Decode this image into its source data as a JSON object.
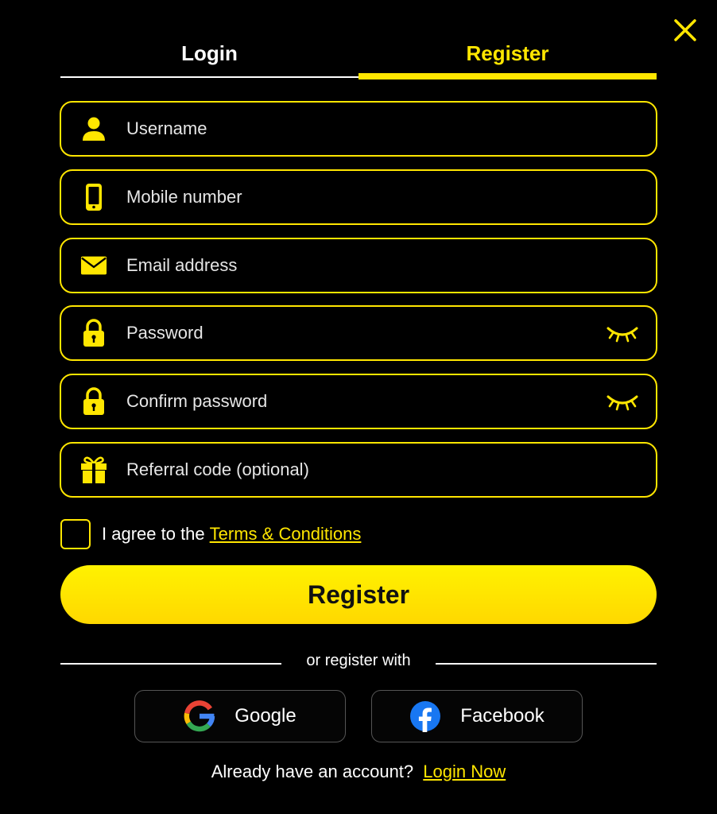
{
  "tabs": {
    "login": "Login",
    "register": "Register",
    "active": "register"
  },
  "form": {
    "username": {
      "placeholder": "Username",
      "value": "",
      "icon": "user-icon"
    },
    "mobile": {
      "placeholder": "Mobile number",
      "value": "",
      "icon": "phone-icon"
    },
    "email": {
      "placeholder": "Email address",
      "value": "",
      "icon": "mail-icon"
    },
    "password": {
      "placeholder": "Password",
      "value": "",
      "icon": "lock-icon",
      "toggle_icon": "eye-closed-icon"
    },
    "confirm_password": {
      "placeholder": "Confirm password",
      "value": "",
      "icon": "lock-icon",
      "toggle_icon": "eye-closed-icon"
    },
    "referral": {
      "placeholder": "Referral code (optional)",
      "value": "",
      "icon": "gift-icon"
    }
  },
  "agree": {
    "text": "I agree to the",
    "link": "Terms & Conditions",
    "checked": false
  },
  "submit_label": "Register",
  "divider_text": "or register with",
  "social": {
    "google": "Google",
    "facebook": "Facebook"
  },
  "footer": {
    "text": "Already have an account?",
    "link": "Login Now"
  },
  "colors": {
    "accent": "#ffe600",
    "background": "#000000",
    "text": "#ffffff",
    "facebook": "#1877f2"
  }
}
